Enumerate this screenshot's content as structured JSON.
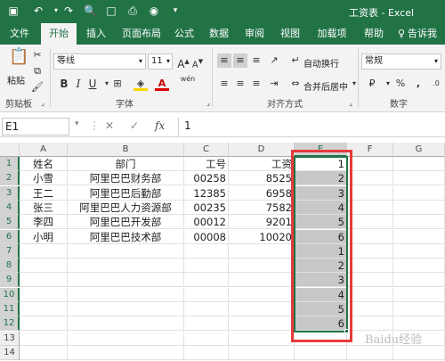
{
  "window": {
    "title": "工资表 - Excel"
  },
  "quick_access": {
    "icons": [
      "save-icon",
      "undo-icon",
      "redo-icon",
      "print-preview-icon",
      "new-file-icon",
      "print-icon",
      "camera-icon",
      "dropdown-icon"
    ]
  },
  "tabs": [
    "文件",
    "开始",
    "插入",
    "页面布局",
    "公式",
    "数据",
    "审阅",
    "视图",
    "加载项",
    "帮助",
    "告诉我你"
  ],
  "ribbon": {
    "clipboard": {
      "paste": "粘贴",
      "label": "剪贴板"
    },
    "font": {
      "name": "等线",
      "size": "11",
      "grow": "A",
      "shrink": "A",
      "bold": "B",
      "italic": "I",
      "underline": "U",
      "fill_letter": "A",
      "phonetic": "wén",
      "label": "字体"
    },
    "alignment": {
      "wrap": "自动换行",
      "merge": "合并后居中",
      "label": "对齐方式"
    },
    "number": {
      "format": "常规",
      "percent": "%",
      "comma": ",",
      "label": "数字"
    }
  },
  "formula_bar": {
    "namebox": "E1",
    "cancel": "✕",
    "enter": "✓",
    "fx": "fx",
    "value": "1"
  },
  "sheet": {
    "columns": [
      "A",
      "B",
      "C",
      "D",
      "E",
      "F",
      "G"
    ],
    "rows": [
      "1",
      "2",
      "3",
      "4",
      "5",
      "6",
      "7",
      "8",
      "9",
      "10",
      "11",
      "12",
      "13",
      "14"
    ],
    "data": [
      [
        "姓名",
        "部门",
        "工号",
        "工资",
        "1"
      ],
      [
        "小雪",
        "阿里巴巴财务部",
        "00258",
        "8525",
        "2"
      ],
      [
        "王二",
        "阿里巴巴后勤部",
        "12385",
        "6958",
        "3"
      ],
      [
        "张三",
        "阿里巴巴人力资源部",
        "00235",
        "7582",
        "4"
      ],
      [
        "李四",
        "阿里巴巴开发部",
        "00012",
        "9201",
        "5"
      ],
      [
        "小明",
        "阿里巴巴技术部",
        "00008",
        "10020",
        "6"
      ],
      [
        "",
        "",
        "",
        "",
        "1"
      ],
      [
        "",
        "",
        "",
        "",
        "2"
      ],
      [
        "",
        "",
        "",
        "",
        "3"
      ],
      [
        "",
        "",
        "",
        "",
        "4"
      ],
      [
        "",
        "",
        "",
        "",
        "5"
      ],
      [
        "",
        "",
        "",
        "",
        "6"
      ]
    ]
  },
  "watermark": "Baidu经验",
  "colors": {
    "excel_green": "#217346",
    "highlight_red": "#e63b3b",
    "selection_gray": "#c8c8c8"
  }
}
